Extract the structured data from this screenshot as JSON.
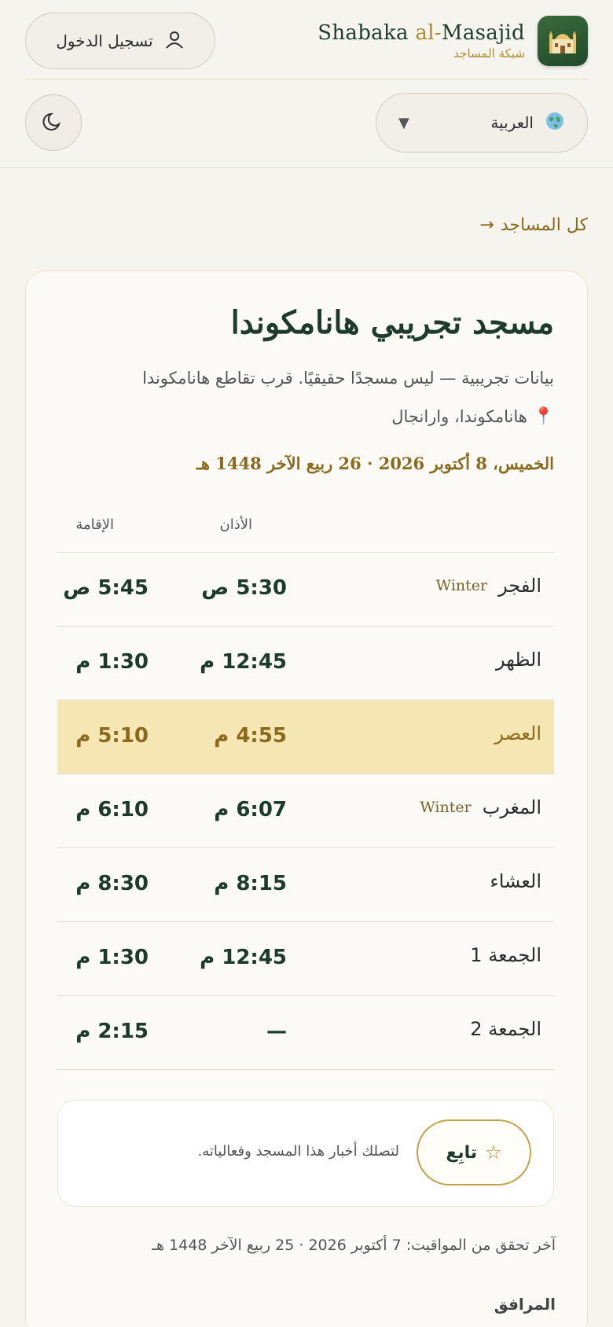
{
  "brand": {
    "name_prefix": "Shabaka ",
    "name_al": "al-",
    "name_suffix": "Masajid",
    "subtitle": "شبكة المساجد",
    "logo_icon": "mosque-icon"
  },
  "header": {
    "login_label": "تسجيل الدخول",
    "login_icon": "user-icon",
    "language_label": "العربية",
    "language_icon": "globe-icon",
    "theme_icon": "moon-icon"
  },
  "nav": {
    "back_label": "كل المساجد",
    "back_arrow": "→"
  },
  "mosque": {
    "title": "مسجد تجريبي هانامكوندا",
    "description": "بيانات تجريبية — ليس مسجدًا حقيقيًا. قرب تقاطع هانامكوندا",
    "address_icon": "📍",
    "address": "هانامكوندا، وارانجال",
    "date": "الخميس، 8 أكتوبر 2026 · 26 ربيع الآخر 1448 هـ"
  },
  "prayer_table": {
    "headers": {
      "adhan": "الأذان",
      "iqama": "الإقامة"
    },
    "rows": [
      {
        "name": "الفجر",
        "tag": "Winter",
        "adhan": "5:30 ص",
        "iqama": "5:45 ص",
        "current": false
      },
      {
        "name": "الظهر",
        "tag": "",
        "adhan": "12:45 م",
        "iqama": "1:30 م",
        "current": false
      },
      {
        "name": "العصر",
        "tag": "",
        "adhan": "4:55 م",
        "iqama": "5:10 م",
        "current": true
      },
      {
        "name": "المغرب",
        "tag": "Winter",
        "adhan": "6:07 م",
        "iqama": "6:10 م",
        "current": false
      },
      {
        "name": "العشاء",
        "tag": "",
        "adhan": "8:15 م",
        "iqama": "8:30 م",
        "current": false
      },
      {
        "name": "الجمعة 1",
        "tag": "",
        "adhan": "12:45 م",
        "iqama": "1:30 م",
        "current": false
      },
      {
        "name": "الجمعة 2",
        "tag": "",
        "adhan": "—",
        "iqama": "2:15 م",
        "current": false
      }
    ]
  },
  "follow": {
    "button_label": "تابِع",
    "star": "☆",
    "text": "لتصلك أخبار هذا المسجد وفعالياته."
  },
  "verified_text": "آخر تحقق من المواقيت: 7 أكتوبر 2026 · 25 ربيع الآخر 1448 هـ",
  "facilities_heading": "المرافق",
  "colors": {
    "accent": "#b08a2a",
    "primary": "#1c3b2b",
    "highlight": "#f6e6b4",
    "background": "#f6f4ee"
  }
}
